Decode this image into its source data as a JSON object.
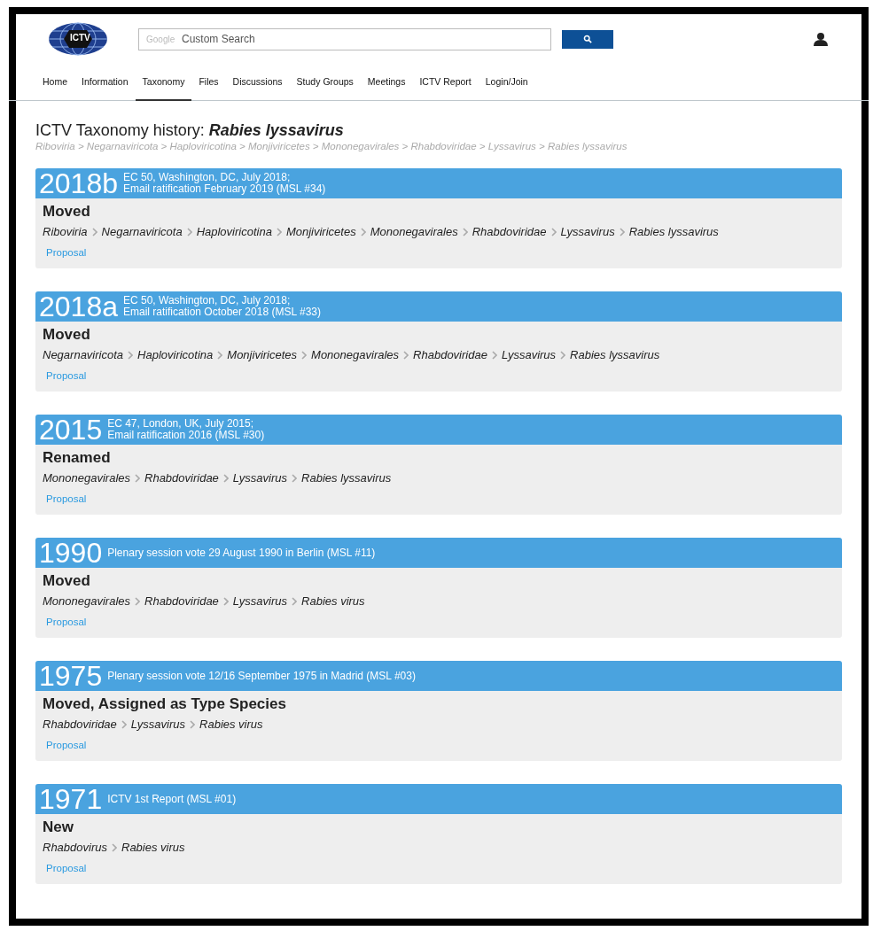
{
  "header": {
    "logo": "ICTV",
    "search": {
      "placeholder": "Custom Search",
      "brand": "Google"
    }
  },
  "nav": [
    {
      "label": "Home",
      "selected": false
    },
    {
      "label": "Information",
      "selected": false
    },
    {
      "label": "Taxonomy",
      "selected": true
    },
    {
      "label": "Files",
      "selected": false
    },
    {
      "label": "Discussions",
      "selected": false
    },
    {
      "label": "Study Groups",
      "selected": false
    },
    {
      "label": "Meetings",
      "selected": false
    },
    {
      "label": "ICTV Report",
      "selected": false
    },
    {
      "label": "Login/Join",
      "selected": false
    }
  ],
  "title": "ICTV Taxonomy history: **Rabies lyssavirus**",
  "lineage": "Riboviria > Negarnaviricota > Haploviricotina > Monjiviricetes > Mononegavirales > Rhabdoviridae > Lyssavirus > Rabies lyssavirus",
  "history": [
    {
      "year": "2018b",
      "meeting": [
        "EC 50, Washington, DC, July 2018;",
        "Email ratification February 2019 (MSL #34)"
      ],
      "action": "Moved",
      "taxa": [
        "Riboviria",
        "Negarnaviricota",
        "Haploviricotina",
        "Monjiviricetes",
        "Mononegavirales",
        "Rhabdoviridae",
        "Lyssavirus",
        "Rabies lyssavirus"
      ],
      "link": "Proposal"
    },
    {
      "year": "2018a",
      "meeting": [
        "EC 50, Washington, DC, July 2018;",
        "Email ratification October 2018 (MSL #33)"
      ],
      "action": "Moved",
      "taxa": [
        "Negarnaviricota",
        "Haploviricotina",
        "Monjiviricetes",
        "Mononegavirales",
        "Rhabdoviridae",
        "Lyssavirus",
        "Rabies lyssavirus"
      ],
      "link": "Proposal"
    },
    {
      "year": "2015",
      "meeting": [
        "EC 47, London, UK, July 2015;",
        "Email ratification 2016 (MSL #30)"
      ],
      "action": "Renamed",
      "taxa": [
        "Mononegavirales",
        "Rhabdoviridae",
        "Lyssavirus",
        "Rabies lyssavirus"
      ],
      "link": "Proposal"
    },
    {
      "year": "1990",
      "meeting": [
        "Plenary session vote 29 August 1990 in Berlin (MSL #11)"
      ],
      "action": "Moved",
      "taxa": [
        "Mononegavirales",
        "Rhabdoviridae",
        "Lyssavirus",
        "Rabies virus"
      ],
      "link": "Proposal"
    },
    {
      "year": "1975",
      "meeting": [
        "Plenary session vote 12/16 September 1975 in Madrid (MSL #03)"
      ],
      "action": "Moved, Assigned as Type Species",
      "taxa": [
        "Rhabdoviridae",
        "Lyssavirus",
        "Rabies virus"
      ],
      "link": "Proposal"
    },
    {
      "year": "1971",
      "meeting": [
        "ICTV 1st Report (MSL #01)"
      ],
      "action": "New",
      "taxa": [
        "Rhabdovirus",
        "Rabies virus"
      ],
      "link": "Proposal"
    }
  ]
}
